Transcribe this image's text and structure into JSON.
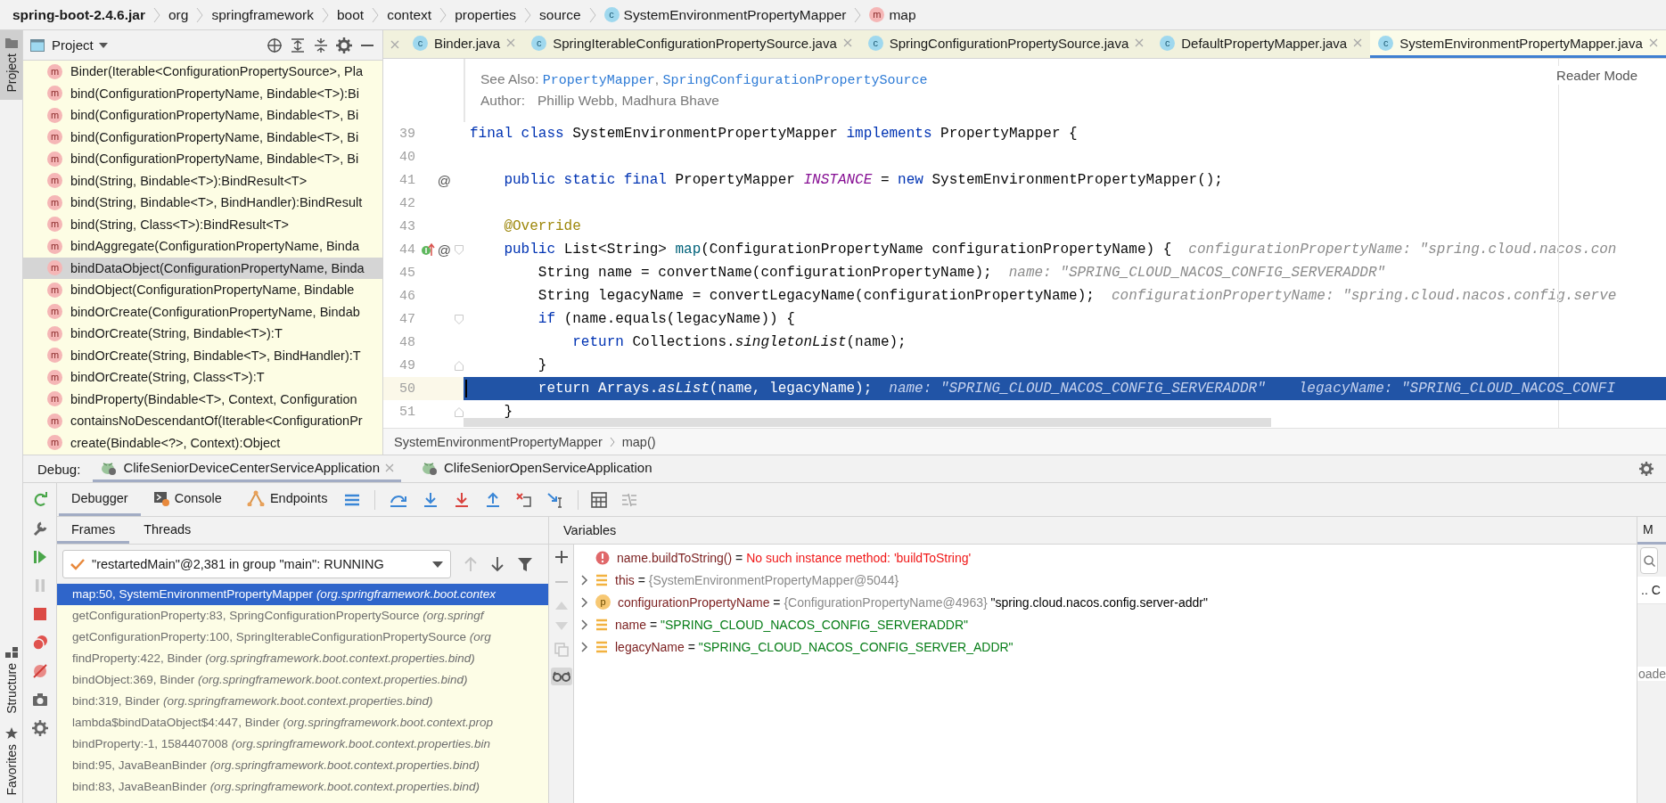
{
  "breadcrumbs": [
    {
      "text": "spring-boot-2.4.6.jar",
      "kind": "jar"
    },
    {
      "text": "org",
      "kind": "package"
    },
    {
      "text": "springframework",
      "kind": "package"
    },
    {
      "text": "boot",
      "kind": "package"
    },
    {
      "text": "context",
      "kind": "package"
    },
    {
      "text": "properties",
      "kind": "package"
    },
    {
      "text": "source",
      "kind": "package"
    },
    {
      "text": "SystemEnvironmentPropertyMapper",
      "kind": "class",
      "badge": "c"
    },
    {
      "text": "map",
      "kind": "method",
      "badge": "m"
    }
  ],
  "left_strip": {
    "top": [
      {
        "label": "Project",
        "selected": true
      }
    ],
    "bottom": [
      {
        "label": "Structure",
        "selected": false
      },
      {
        "label": "Favorites",
        "selected": false
      }
    ]
  },
  "project_panel": {
    "title": "Project",
    "items": [
      {
        "badge": "m",
        "label": "Binder(Iterable<ConfigurationPropertySource>, Pla",
        "selected": false
      },
      {
        "badge": "m",
        "label": "bind(ConfigurationPropertyName, Bindable<T>):Bi",
        "selected": false
      },
      {
        "badge": "m",
        "label": "bind(ConfigurationPropertyName, Bindable<T>, Bi",
        "selected": false
      },
      {
        "badge": "m",
        "label": "bind(ConfigurationPropertyName, Bindable<T>, Bi",
        "selected": false
      },
      {
        "badge": "m",
        "label": "bind(ConfigurationPropertyName, Bindable<T>, Bi",
        "selected": false
      },
      {
        "badge": "m",
        "label": "bind(String, Bindable<T>):BindResult<T>",
        "selected": false
      },
      {
        "badge": "m",
        "label": "bind(String, Bindable<T>, BindHandler):BindResult",
        "selected": false
      },
      {
        "badge": "m",
        "label": "bind(String, Class<T>):BindResult<T>",
        "selected": false
      },
      {
        "badge": "m",
        "label": "bindAggregate(ConfigurationPropertyName, Binda",
        "selected": false
      },
      {
        "badge": "m",
        "label": "bindDataObject(ConfigurationPropertyName, Binda",
        "selected": true
      },
      {
        "badge": "m",
        "label": "bindObject(ConfigurationPropertyName, Bindable",
        "selected": false
      },
      {
        "badge": "m",
        "label": "bindOrCreate(ConfigurationPropertyName, Bindab",
        "selected": false
      },
      {
        "badge": "m",
        "label": "bindOrCreate(String, Bindable<T>):T",
        "selected": false
      },
      {
        "badge": "m",
        "label": "bindOrCreate(String, Bindable<T>, BindHandler):T",
        "selected": false
      },
      {
        "badge": "m",
        "label": "bindOrCreate(String, Class<T>):T",
        "selected": false
      },
      {
        "badge": "m",
        "label": "bindProperty(Bindable<T>, Context, Configuration",
        "selected": false
      },
      {
        "badge": "m",
        "label": "containsNoDescendantOf(Iterable<ConfigurationPr",
        "selected": false
      },
      {
        "badge": "m",
        "label": "create(Bindable<?>, Context):Object",
        "selected": false
      }
    ]
  },
  "editor": {
    "tabs": [
      {
        "badge": "c",
        "label": "Binder.java",
        "selected": false
      },
      {
        "badge": "c",
        "label": "SpringIterableConfigurationPropertySource.java",
        "selected": false
      },
      {
        "badge": "c",
        "label": "SpringConfigurationPropertySource.java",
        "selected": false
      },
      {
        "badge": "c",
        "label": "DefaultPropertyMapper.java",
        "selected": false
      },
      {
        "badge": "c",
        "label": "SystemEnvironmentPropertyMapper.java",
        "selected": true
      }
    ],
    "reader_mode": "Reader Mode",
    "doc": {
      "see_also_label": "See Also:",
      "see_also": [
        {
          "kind": "link",
          "text": "PropertyMapper"
        },
        {
          "kind": "text",
          "text": ", "
        },
        {
          "kind": "link",
          "text": "SpringConfigurationPropertySource"
        }
      ],
      "author_label": "Author:",
      "authors": "Phillip Webb, Madhura Bhave"
    },
    "lines": [
      {
        "no": "39",
        "tokens": [
          {
            "kind": "keyword",
            "text": "final class "
          },
          {
            "kind": "plain",
            "text": "SystemEnvironmentPropertyMapper "
          },
          {
            "kind": "keyword",
            "text": "implements "
          },
          {
            "kind": "plain",
            "text": "PropertyMapper {"
          }
        ]
      },
      {
        "no": "40"
      },
      {
        "no": "41",
        "marks": [
          {
            "kind": "at",
            "text": "@"
          }
        ],
        "tokens": [
          {
            "kind": "keyword",
            "text": "    public static final "
          },
          {
            "kind": "plain",
            "text": "PropertyMapper "
          },
          {
            "kind": "static",
            "text": "INSTANCE"
          },
          {
            "kind": "plain",
            "text": " = "
          },
          {
            "kind": "keyword",
            "text": "new "
          },
          {
            "kind": "plain",
            "text": "SystemEnvironmentPropertyMapper();"
          }
        ]
      },
      {
        "no": "42"
      },
      {
        "no": "43",
        "tokens": [
          {
            "kind": "annotation",
            "text": "    @Override"
          }
        ]
      },
      {
        "no": "44",
        "marks": [
          {
            "kind": "implements"
          },
          {
            "kind": "at",
            "text": "@"
          }
        ],
        "fold_start": true,
        "tokens": [
          {
            "kind": "keyword",
            "text": "    public "
          },
          {
            "kind": "plain",
            "text": "List<String> "
          },
          {
            "kind": "method",
            "text": "map"
          },
          {
            "kind": "plain",
            "text": "(ConfigurationPropertyName configurationPropertyName) {"
          }
        ],
        "hints": [
          "configurationPropertyName: \"spring.cloud.nacos.con"
        ]
      },
      {
        "no": "45",
        "tokens": [
          {
            "kind": "plain",
            "text": "        String name = convertName(configurationPropertyName);"
          }
        ],
        "hints": [
          "name: \"SPRING_CLOUD_NACOS_CONFIG_SERVERADDR\""
        ]
      },
      {
        "no": "46",
        "tokens": [
          {
            "kind": "plain",
            "text": "        String legacyName = convertLegacyName(configurationPropertyName);"
          }
        ],
        "hints": [
          "configurationPropertyName: \"spring.cloud.nacos.config.serve"
        ]
      },
      {
        "no": "47",
        "fold_start": true,
        "tokens": [
          {
            "kind": "keyword",
            "text": "        if "
          },
          {
            "kind": "plain",
            "text": "(name.equals(legacyName)) {"
          }
        ]
      },
      {
        "no": "48",
        "tokens": [
          {
            "kind": "keyword",
            "text": "            return "
          },
          {
            "kind": "plain",
            "text": "Collections."
          },
          {
            "kind": "italic",
            "text": "singletonList"
          },
          {
            "kind": "plain",
            "text": "(name);"
          }
        ]
      },
      {
        "no": "49",
        "fold_end": true,
        "tokens": [
          {
            "kind": "plain",
            "text": "        }"
          }
        ]
      },
      {
        "no": "50",
        "current": true,
        "tokens": [
          {
            "kind": "keyword",
            "text": "        return "
          },
          {
            "kind": "plain",
            "text": "Arrays."
          },
          {
            "kind": "italic",
            "text": "asList"
          },
          {
            "kind": "plain",
            "text": "(name, legacyName);"
          }
        ],
        "hints": [
          "name: \"SPRING_CLOUD_NACOS_CONFIG_SERVERADDR\"",
          "legacyName: \"SPRING_CLOUD_NACOS_CONFI"
        ]
      },
      {
        "no": "51",
        "fold_end": true,
        "tokens": [
          {
            "kind": "plain",
            "text": "    }"
          }
        ]
      }
    ],
    "breadcrumbs": [
      "SystemEnvironmentPropertyMapper",
      "map()"
    ]
  },
  "debug": {
    "title": "Debug:",
    "sessions": [
      {
        "label": "ClifeSeniorDeviceCenterServiceApplication",
        "selected": true
      },
      {
        "label": "ClifeSeniorOpenServiceApplication",
        "selected": false
      }
    ],
    "tabs": [
      {
        "label": "Debugger",
        "selected": true
      },
      {
        "label": "Console",
        "selected": false
      },
      {
        "label": "Endpoints",
        "selected": false
      }
    ],
    "frame_tabs": [
      {
        "label": "Frames",
        "selected": true
      },
      {
        "label": "Threads",
        "selected": false
      }
    ],
    "thread": "\"restartedMain\"@2,381 in group \"main\": RUNNING",
    "frames": [
      {
        "text": "map:50, SystemEnvironmentPropertyMapper *(org.springframework.boot.contex*",
        "selected": true
      },
      {
        "text": "getConfigurationProperty:83, SpringConfigurationPropertySource *(org.springf*",
        "selected": false
      },
      {
        "text": "getConfigurationProperty:100, SpringIterableConfigurationPropertySource *(org*",
        "selected": false
      },
      {
        "text": "findProperty:422, Binder *(org.springframework.boot.context.properties.bind)*",
        "selected": false
      },
      {
        "text": "bindObject:369, Binder *(org.springframework.boot.context.properties.bind)*",
        "selected": false
      },
      {
        "text": "bind:319, Binder *(org.springframework.boot.context.properties.bind)*",
        "selected": false
      },
      {
        "text": "lambda$bindDataObject$4:447, Binder *(org.springframework.boot.context.prop*",
        "selected": false
      },
      {
        "text": "bindProperty:-1, 1584407008 *(org.springframework.boot.context.properties.bin*",
        "selected": false
      },
      {
        "text": "bind:95, JavaBeanBinder *(org.springframework.boot.context.properties.bind)*",
        "selected": false
      },
      {
        "text": "bind:83, JavaBeanBinder *(org.springframework.boot.context.properties.bind)*",
        "selected": false
      }
    ],
    "variables_title": "Variables",
    "variables": [
      {
        "kind": "error",
        "expandable": false,
        "name": "name.buildToString()",
        "op": "=",
        "value": [
          {
            "kind": "error",
            "text": "No such instance method: 'buildToString'"
          }
        ]
      },
      {
        "kind": "field",
        "expandable": true,
        "name": "this",
        "op": "=",
        "value": [
          {
            "kind": "ref",
            "text": "{SystemEnvironmentPropertyMapper@5044}"
          }
        ]
      },
      {
        "kind": "param",
        "badge": "p",
        "expandable": true,
        "name": "configurationPropertyName",
        "op": "=",
        "value": [
          {
            "kind": "ref",
            "text": "{ConfigurationPropertyName@4963}"
          },
          {
            "kind": "plain",
            "text": "\"spring.cloud.nacos.config.server-addr\""
          }
        ]
      },
      {
        "kind": "field",
        "expandable": true,
        "name": "name",
        "op": "=",
        "value": [
          {
            "kind": "string",
            "text": "\"SPRING_CLOUD_NACOS_CONFIG_SERVERADDR\""
          }
        ]
      },
      {
        "kind": "field",
        "expandable": true,
        "name": "legacyName",
        "op": "=",
        "value": [
          {
            "kind": "string",
            "text": "\"SPRING_CLOUD_NACOS_CONFIG_SERVER_ADDR\""
          }
        ]
      }
    ],
    "side_panel": {
      "tab": "M",
      "cells": [
        "..",
        "C"
      ],
      "text": "oade"
    }
  }
}
